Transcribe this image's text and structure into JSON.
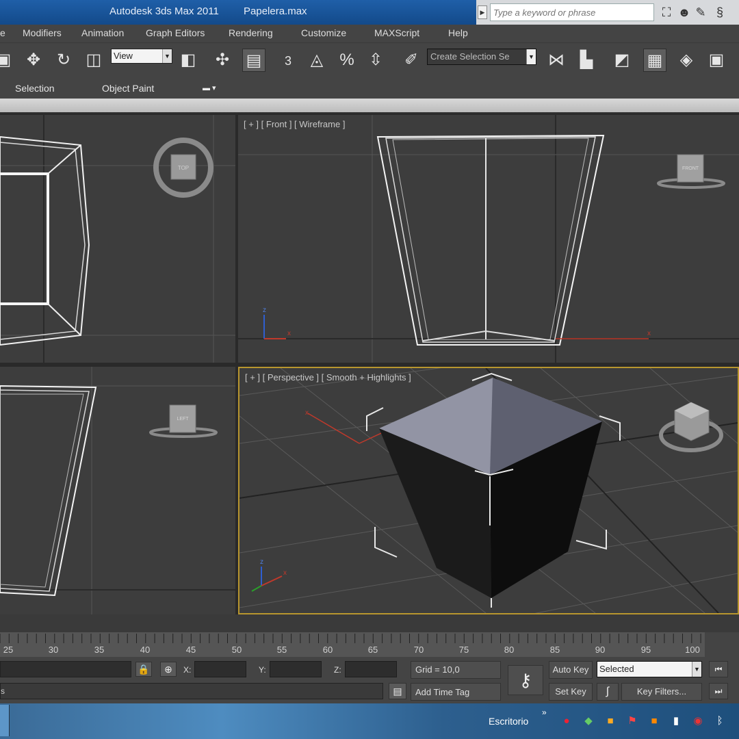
{
  "titlebar": {
    "app_title": "Autodesk 3ds Max  2011",
    "file_name": "Papelera.max",
    "search_placeholder": "Type a keyword or phrase"
  },
  "menu": [
    "e",
    "Modifiers",
    "Animation",
    "Graph Editors",
    "Rendering",
    "Customize",
    "MAXScript",
    "Help"
  ],
  "toolbar": {
    "reference_coord": "View",
    "snap_label": "3",
    "selection_set_placeholder": "Create Selection Se"
  },
  "ribbon": {
    "tabs": [
      "Selection",
      "Object Paint"
    ]
  },
  "viewports": {
    "top": {
      "cube_label": "TOP"
    },
    "front": {
      "label": "[ + ] [ Front ] [ Wireframe ]",
      "cube_label": "FRONT"
    },
    "left": {
      "cube_label": "LEFT"
    },
    "perspective": {
      "label": "[ + ] [ Perspective ] [ Smooth + Highlights ]"
    }
  },
  "timeline": {
    "frames": [
      "25",
      "30",
      "35",
      "40",
      "45",
      "50",
      "55",
      "60",
      "65",
      "70",
      "75",
      "80",
      "85",
      "90",
      "95",
      "100"
    ]
  },
  "status": {
    "prompt_fragment": "s",
    "x_label": "X:",
    "y_label": "Y:",
    "z_label": "Z:",
    "grid": "Grid = 10,0",
    "add_time_tag": "Add Time Tag",
    "auto_key": "Auto Key",
    "set_key": "Set Key",
    "key_mode": "Selected",
    "key_filters": "Key Filters..."
  },
  "taskbar": {
    "desktop_label": "Escritorio"
  }
}
